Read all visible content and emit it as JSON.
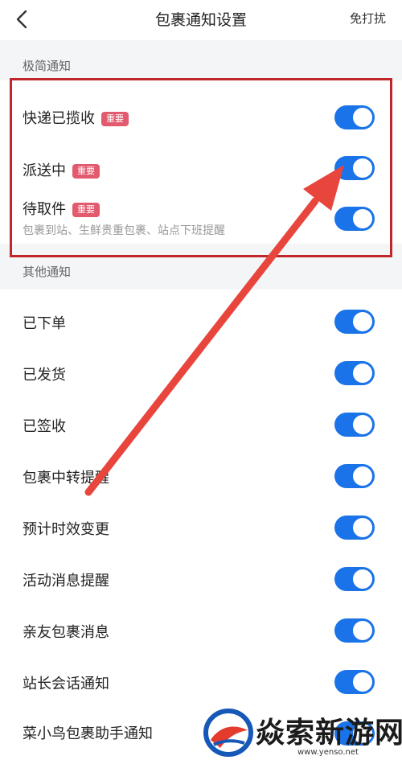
{
  "header": {
    "title": "包裹通知设置",
    "action_label": "免打扰",
    "back_icon": "chevron-left-icon"
  },
  "sections": {
    "minimal": {
      "label": "极简通知",
      "items": [
        {
          "label": "快递已揽收",
          "badge": "重要",
          "enabled": true
        },
        {
          "label": "派送中",
          "badge": "重要",
          "enabled": true
        },
        {
          "label": "待取件",
          "badge": "重要",
          "subtitle": "包裹到站、生鲜贵重包裹、站点下班提醒",
          "enabled": true
        }
      ]
    },
    "other": {
      "label": "其他通知",
      "items": [
        {
          "label": "已下单",
          "enabled": true
        },
        {
          "label": "已发货",
          "enabled": true
        },
        {
          "label": "已签收",
          "enabled": true
        },
        {
          "label": "包裹中转提醒",
          "enabled": true
        },
        {
          "label": "预计时效变更",
          "enabled": true
        },
        {
          "label": "活动消息提醒",
          "enabled": true
        },
        {
          "label": "亲友包裹消息",
          "enabled": true
        },
        {
          "label": "站长会话通知",
          "enabled": true
        },
        {
          "label": "菜小鸟包裹助手通知",
          "enabled": true
        }
      ]
    }
  },
  "colors": {
    "toggle_on": "#1a73e8",
    "badge": "#e25a6e",
    "annotation": "#c0262a",
    "arrow": "#e8453c"
  },
  "watermark": {
    "text": "焱索新游网",
    "url": "www.yenso.net"
  }
}
